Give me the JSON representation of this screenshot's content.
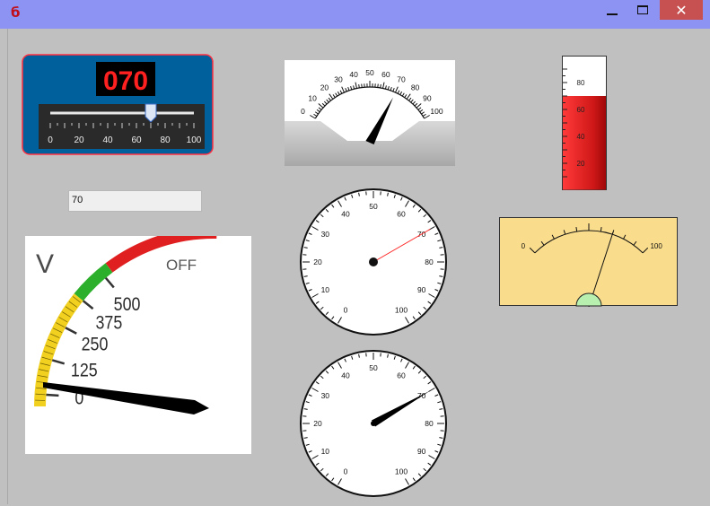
{
  "window": {
    "icon": "app-icon",
    "minimize_icon": "minimize-icon",
    "maximize_icon": "maximize-icon",
    "close_icon": "close-icon",
    "close_glyph": "✕"
  },
  "value": 70,
  "value_text": "70",
  "panel": {
    "display_text": "070",
    "slider_value": 70,
    "ticks": [
      "0",
      "20",
      "40",
      "60",
      "80",
      "100"
    ],
    "bg_color": "#00609c",
    "border_color": "#ff3040",
    "digit_color": "#ff2020"
  },
  "arc_meter": {
    "ticks": [
      "0",
      "10",
      "20",
      "30",
      "40",
      "50",
      "60",
      "70",
      "80",
      "90",
      "100"
    ],
    "value": 70
  },
  "thermometer": {
    "ticks": [
      "80",
      "60",
      "40",
      "20"
    ],
    "value": 70,
    "fill_color": "#e02020"
  },
  "circle_gauge_1": {
    "ticks": [
      "0",
      "10",
      "20",
      "30",
      "40",
      "50",
      "60",
      "70",
      "80",
      "90",
      "100"
    ],
    "value": 70,
    "needle_color": "#ff2020"
  },
  "circle_gauge_2": {
    "ticks": [
      "0",
      "10",
      "20",
      "30",
      "40",
      "50",
      "60",
      "70",
      "80",
      "90",
      "100"
    ],
    "value": 70
  },
  "panel_meter": {
    "min_label": "0",
    "max_label": "100",
    "value": 70,
    "bg_color": "#fadd8c",
    "pivot_color": "#b8f0b0"
  },
  "voltmeter": {
    "unit": "V",
    "off_label": "OFF",
    "labels": [
      "0",
      "125",
      "250",
      "375",
      "500"
    ],
    "value": 0,
    "zone_colors": {
      "yellow": "#f2d020",
      "green": "#2cb02c",
      "red": "#e02020"
    }
  }
}
